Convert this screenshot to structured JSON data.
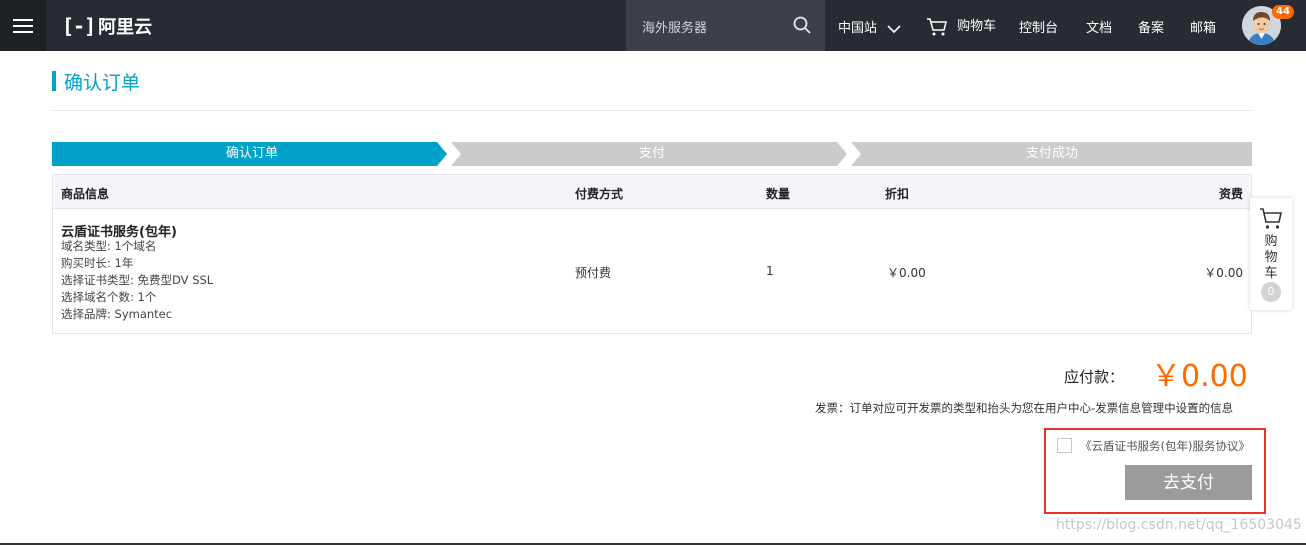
{
  "header": {
    "logo_mark": "[-]",
    "logo_text": "阿里云",
    "search_placeholder": "海外服务器",
    "nav": {
      "region": "中国站",
      "cart": "购物车",
      "console": "控制台",
      "docs": "文档",
      "filing": "备案",
      "mail": "邮箱"
    },
    "notification_count": "44"
  },
  "page": {
    "title": "确认订单"
  },
  "steps": [
    {
      "label": "确认订单",
      "active": true
    },
    {
      "label": "支付",
      "active": false
    },
    {
      "label": "支付成功",
      "active": false
    }
  ],
  "table": {
    "headers": {
      "product": "商品信息",
      "payment": "付费方式",
      "quantity": "数量",
      "discount": "折扣",
      "fee": "资费"
    },
    "row": {
      "name": "云盾证书服务(包年)",
      "details": [
        "域名类型: 1个域名",
        "购买时长: 1年",
        "选择证书类型: 免费型DV SSL",
        "选择域名个数: 1个",
        "选择品牌: Symantec"
      ],
      "payment": "预付费",
      "quantity": "1",
      "discount": "￥0.00",
      "fee": "￥0.00"
    }
  },
  "summary": {
    "amount_label": "应付款：",
    "amount_value": "￥0.00",
    "invoice_note": "发票：订单对应可开发票的类型和抬头为您在用户中心-发票信息管理中设置的信息",
    "agreement_text": "《云盾证书服务(包年)服务协议》",
    "agreement_checked": false,
    "pay_button": "去支付"
  },
  "cart_float": {
    "label": "购物车",
    "count": "0"
  },
  "watermark": "https://blog.csdn.net/qq_16503045",
  "colors": {
    "topbar": "#272c32",
    "accent": "#00a2ca",
    "price": "#ff6a00",
    "highlight_border": "#e5332a",
    "pay_button": "#9b9b9b"
  }
}
